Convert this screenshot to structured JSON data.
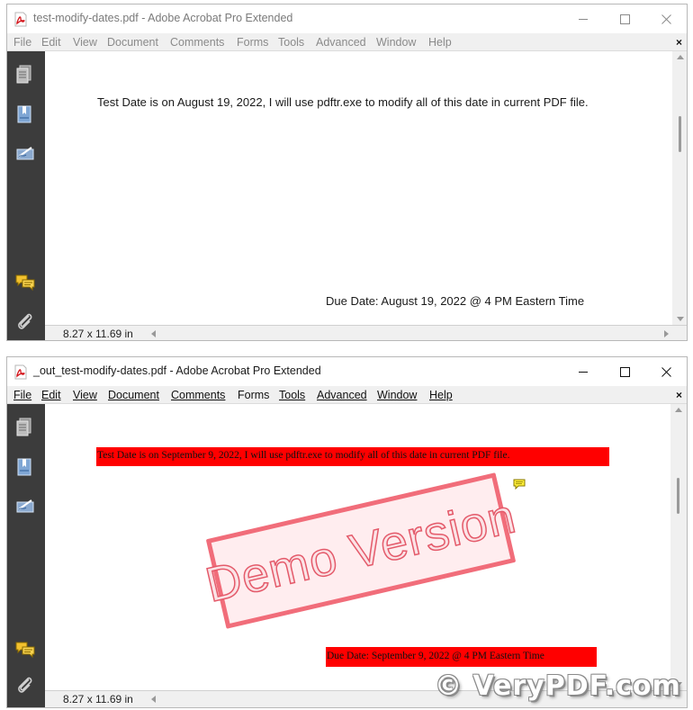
{
  "windows": [
    {
      "title": "test-modify-dates.pdf - Adobe Acrobat Pro Extended",
      "menu": [
        {
          "label": "File"
        },
        {
          "label": "Edit"
        },
        {
          "label": "View"
        },
        {
          "label": "Document"
        },
        {
          "label": "Comments"
        },
        {
          "label": "Forms"
        },
        {
          "label": "Tools"
        },
        {
          "label": "Advanced"
        },
        {
          "label": "Window"
        },
        {
          "label": "Help"
        }
      ],
      "document_close": "×",
      "page": {
        "line1": "Test Date is on August 19, 2022, I will use pdftr.exe to modify all of this date in current PDF file.",
        "line2": "Due Date: August 19, 2022 @ 4 PM Eastern Time"
      },
      "status": {
        "page_size": "8.27 x 11.69 in"
      }
    },
    {
      "title": "_out_test-modify-dates.pdf - Adobe Acrobat Pro Extended",
      "menu": [
        {
          "label": "File"
        },
        {
          "label": "Edit"
        },
        {
          "label": "View"
        },
        {
          "label": "Document"
        },
        {
          "label": "Comments"
        },
        {
          "label": "Forms"
        },
        {
          "label": "Tools"
        },
        {
          "label": "Advanced"
        },
        {
          "label": "Window"
        },
        {
          "label": "Help"
        }
      ],
      "document_close": "×",
      "page": {
        "line1": "Test Date is on September 9, 2022, I will use pdftr.exe to modify all of this date in current PDF file.",
        "line2": "Due Date: September 9, 2022 @ 4 PM Eastern Time",
        "stamp": "Demo Version"
      },
      "status": {
        "page_size": "8.27 x 11.69 in"
      }
    }
  ],
  "watermark": "© VeryPDF.com",
  "colors": {
    "highlight": "#ff0000",
    "stamp_border": "#f16d7a",
    "nav_panel": "#3c3c3c"
  },
  "icons": [
    "pdf-file-icon",
    "pages-icon",
    "bookmarks-icon",
    "signatures-icon",
    "comments-icon",
    "attachments-icon",
    "note-icon"
  ]
}
